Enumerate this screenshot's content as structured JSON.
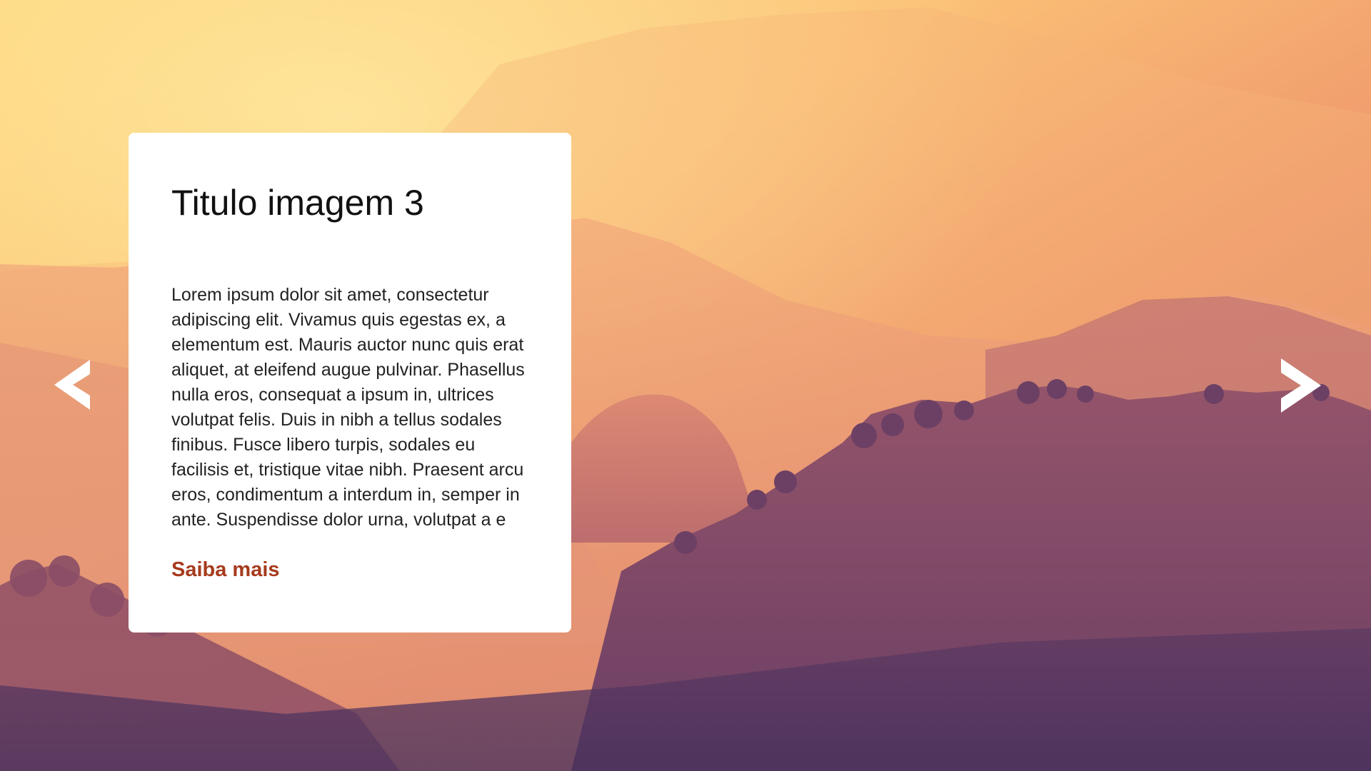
{
  "slide": {
    "title": "Titulo imagem 3",
    "body": "Lorem ipsum dolor sit amet, consectetur adipiscing elit. Vivamus quis egestas ex, a elementum est. Mauris auctor nunc quis erat aliquet, at eleifend augue pulvinar. Phasellus nulla eros, consequat a ipsum in, ultrices volutpat felis. Duis in nibh a tellus sodales finibus. Fusce libero turpis, sodales eu facilisis et, tristique vitae nibh. Praesent arcu eros, condimentum a interdum in, semper in ante. Suspendisse dolor urna, volutpat a e",
    "link_label": "Saiba mais"
  },
  "navigation": {
    "prev_icon": "chevron-left-icon",
    "next_icon": "chevron-right-icon"
  },
  "colors": {
    "link": "#a63a1c",
    "card_background": "#ffffff",
    "arrow": "#ffffff"
  }
}
